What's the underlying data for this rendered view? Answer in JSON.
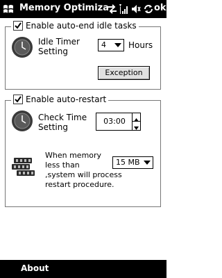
{
  "title_bar": {
    "title": "Memory Optimizat",
    "ok_label": "ok"
  },
  "idle_group": {
    "checkbox_label": "Enable auto-end idle tasks",
    "checked": true,
    "timer_label_line1": "Idle Timer",
    "timer_label_line2": "Setting",
    "timer_value": "4",
    "timer_unit": "Hours",
    "exception_label": "Exception"
  },
  "restart_group": {
    "checkbox_label": "Enable auto-restart",
    "checked": true,
    "check_time_line1": "Check Time",
    "check_time_line2": "Setting",
    "check_time_value": "03:00",
    "memory_text_line1": "When memory",
    "memory_text_line2": "less than",
    "memory_text_line3": ",system will process",
    "memory_text_line4": "restart procedure.",
    "memory_value": "15 MB"
  },
  "soft_keys": {
    "left_label": "About"
  },
  "icons": [
    "windows-flag-icon",
    "connectivity-icon",
    "signal-icon",
    "volume-icon",
    "sync-icon",
    "clock-icon",
    "memory-chips-icon"
  ],
  "colors": {
    "bar_background": "#000000",
    "bar_text": "#ffffff",
    "content_background": "#ffffff",
    "group_border": "#777777"
  }
}
